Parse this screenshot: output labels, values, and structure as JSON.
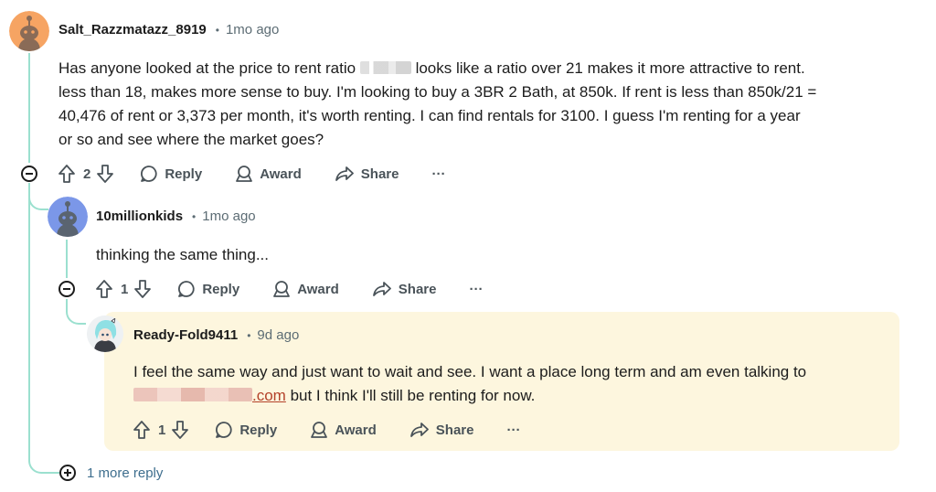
{
  "comments": [
    {
      "author": "Salt_Razzmatazz_8919",
      "time": "1mo ago",
      "lines": [
        "Has anyone looked at the price to rent ratio",
        "looks like a ratio over 21 makes it more attractive to rent.",
        "less than 18, makes more sense to buy. I'm looking to buy a 3BR 2 Bath, at 850k. If rent is less than 850k/21 =",
        "40,476 of rent or 3,373 per month, it's worth renting. I can find rentals for 3100. I guess I'm renting for a year",
        "or so and see where the market goes?"
      ],
      "votes": "2",
      "reply": "Reply",
      "award": "Award",
      "share": "Share",
      "more": "···"
    },
    {
      "author": "10millionkids",
      "time": "1mo ago",
      "lines": [
        "thinking the same thing..."
      ],
      "votes": "1",
      "reply": "Reply",
      "award": "Award",
      "share": "Share",
      "more": "···"
    },
    {
      "author": "Ready-Fold9411",
      "time": "9d ago",
      "lines": [
        "I feel the same way and just want to wait and see. I want a place long term and am even talking to",
        ".com",
        "but I think I'll still be renting for now."
      ],
      "votes": "1",
      "reply": "Reply",
      "award": "Award",
      "share": "Share",
      "more": "···"
    }
  ],
  "more_replies": "1 more reply",
  "sep": "•",
  "colors": {
    "thread_line": "#9be0cf",
    "highlight_bg": "#fdf6de",
    "link": "#b4422a"
  },
  "icons": [
    "reddit-avatar-orange",
    "reddit-avatar-blue",
    "anime-avatar",
    "upvote-icon",
    "downvote-icon",
    "reply-bubble-icon",
    "award-icon",
    "share-icon",
    "more-icon",
    "collapse-icon",
    "expand-icon"
  ]
}
